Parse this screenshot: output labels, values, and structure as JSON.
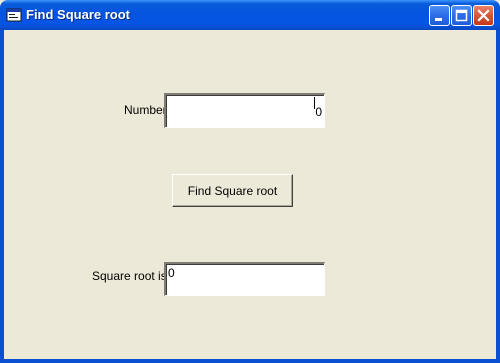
{
  "window": {
    "title": "Find Square root",
    "controls": {
      "minimize_icon": "minimize-icon",
      "maximize_icon": "maximize-icon",
      "close_icon": "close-icon"
    }
  },
  "form": {
    "number_label": "Number",
    "number_value": "0",
    "find_button_label": "Find Square root",
    "result_label": "Square root is",
    "result_value": "0"
  },
  "colors": {
    "titlebar": "#0553E0",
    "client_background": "#ECE9D8",
    "close_button": "#D8553A"
  }
}
